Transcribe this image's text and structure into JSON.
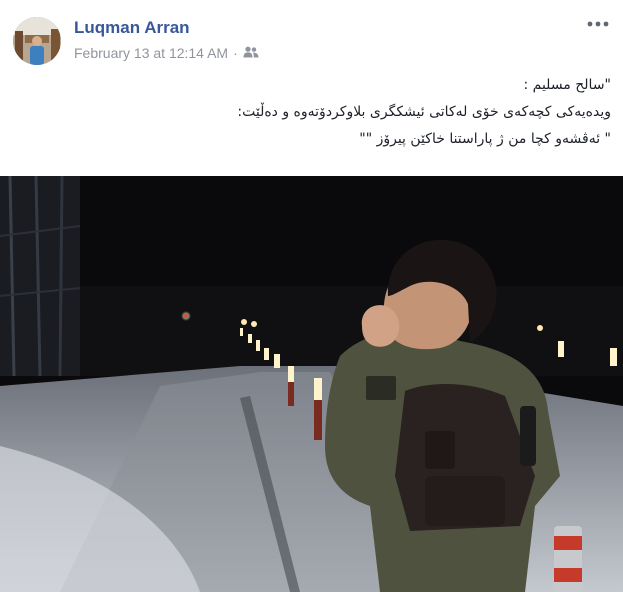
{
  "post": {
    "author": "Luqman Arran",
    "timestamp": "February 13 at 12:14 AM",
    "separator": "·",
    "audience_icon": "friends-icon",
    "more_icon": "more-options-icon",
    "text_lines": [
      "\"سالح مسلیم :",
      "ویدەیەکی کچەکەی خۆی لەکاتی ئیشکگری بلاوکردۆتەوە و دەڵێت:",
      "\" ئەڤشەو کچا من ژ پاراستنا خاکێن پیرۆز \"\""
    ]
  },
  "colors": {
    "author_link": "#385898",
    "meta_text": "#90949c",
    "body_text": "#1d2129",
    "photo_night": "#0a0a0c",
    "snow": "#cfd3da",
    "jacket": "#4f523e"
  }
}
